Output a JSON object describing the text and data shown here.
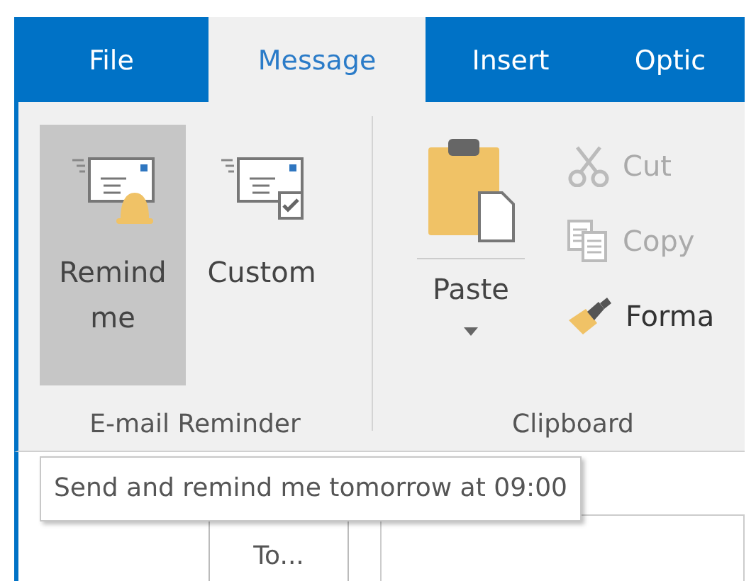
{
  "tabs": [
    {
      "label": "File",
      "selected": false
    },
    {
      "label": "Message",
      "selected": true
    },
    {
      "label": "Insert",
      "selected": false
    },
    {
      "label": "Optic",
      "selected": false
    }
  ],
  "reminder_group": {
    "label": "E-mail Reminder",
    "buttons": [
      {
        "label": "Remind me",
        "kind": "remind",
        "hovered": true
      },
      {
        "label": "Custom",
        "kind": "custom",
        "hovered": false
      }
    ]
  },
  "clipboard_group": {
    "label": "Clipboard",
    "paste": {
      "label": "Paste"
    },
    "buttons": [
      {
        "label": "Cut",
        "kind": "cut",
        "disabled": true
      },
      {
        "label": "Copy",
        "kind": "copy",
        "disabled": true
      },
      {
        "label": "Forma",
        "kind": "format",
        "disabled": false
      }
    ]
  },
  "tooltip": {
    "text": "Send and remind me tomorrow at 09:00"
  },
  "form": {
    "to_button": "To..."
  }
}
